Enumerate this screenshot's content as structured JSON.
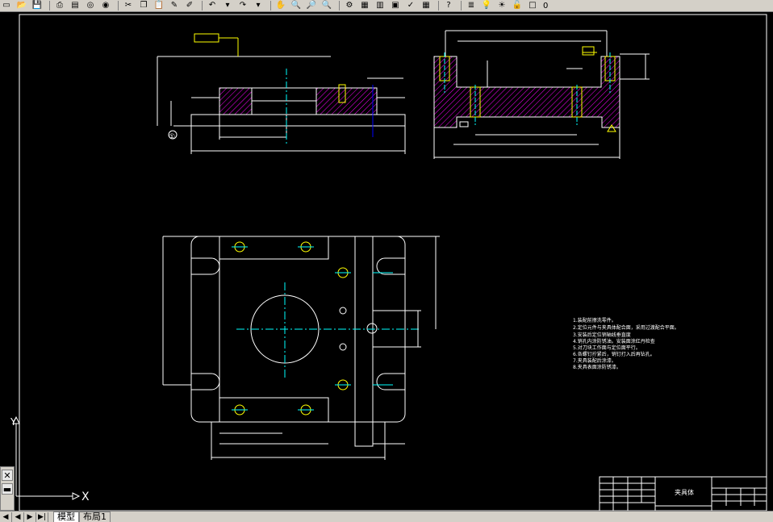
{
  "toolbar": {
    "layer_value": "0",
    "icons": [
      "new-file-icon",
      "open-file-icon",
      "save-icon",
      "print-icon",
      "print-preview-icon",
      "publish-icon",
      "cut-icon",
      "copy-icon",
      "paste-icon",
      "match-properties-icon",
      "undo-icon",
      "redo-icon",
      "pan-icon",
      "zoom-realtime-icon",
      "zoom-window-icon",
      "zoom-previous-icon",
      "properties-icon",
      "design-center-icon",
      "tool-palettes-icon",
      "markup-icon",
      "calc-icon",
      "help-icon",
      "layer-manager-icon"
    ]
  },
  "drawing": {
    "labels": {
      "marker_circle": "①",
      "tech_req_1": "1.装配前擦洗零件。",
      "tech_req_2": "2.定位元件与夹具体配合面，采用过渡配合平面。",
      "tech_req_3": "3.安装后定位销轴线垂直度",
      "tech_req_4": "4.销孔内涂防锈油。安装面涂红丹检查",
      "tech_req_5": "5.对刀块工作面与定位面平行。",
      "tech_req_6": "6.各螺钉拧紧后，销钉打入后再钻孔。",
      "tech_req_7": "7.夹具装配后涂漆。",
      "tech_req_8": "8.夹具表面涂防锈漆。",
      "title_block_name": "夹具体"
    },
    "colors": {
      "outline": "#ffffff",
      "center": "#00ffff",
      "dimension": "#ffffff",
      "hatch": "#ff00ff",
      "hidden": "#ffff00",
      "holes": "#ffff00",
      "axis": "#ffffff"
    }
  },
  "ucs": {
    "x_label": "X",
    "y_label": "Y"
  },
  "tabs": {
    "model": "模型",
    "layout1": "布局1"
  },
  "nav": {
    "first": "◀",
    "prev": "◀",
    "next": "▶",
    "last": "▶|"
  },
  "left_panel": {
    "close": "✕"
  }
}
